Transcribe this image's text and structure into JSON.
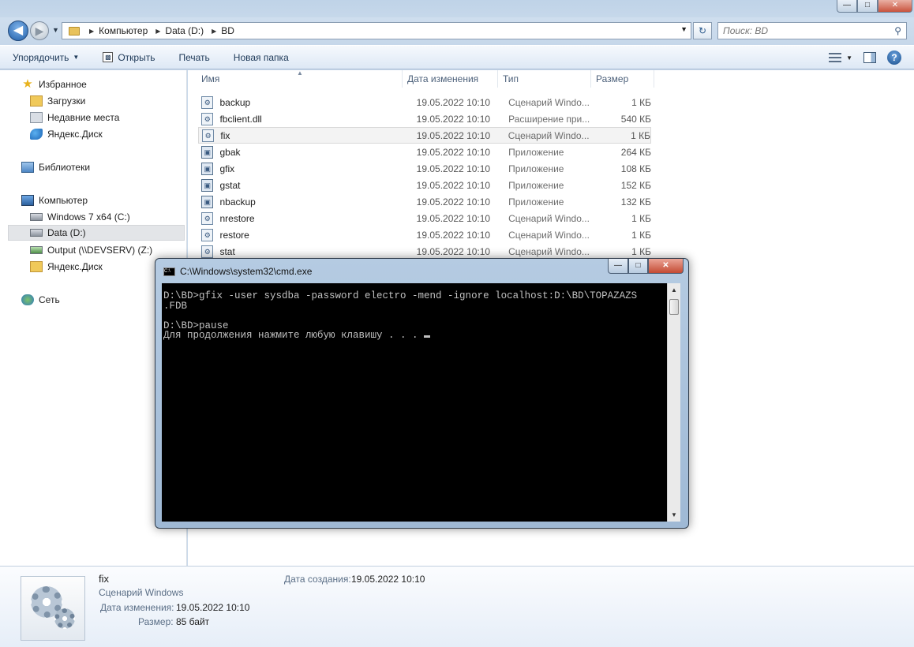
{
  "nav": {
    "crumbs": [
      "Компьютер",
      "Data (D:)",
      "BD"
    ],
    "search_placeholder": "Поиск: BD"
  },
  "toolbar": {
    "organize": "Упорядочить",
    "open": "Открыть",
    "print": "Печать",
    "new_folder": "Новая папка"
  },
  "sidebar": {
    "items": [
      {
        "label": "Избранное"
      },
      {
        "label": "Загрузки"
      },
      {
        "label": "Недавние места"
      },
      {
        "label": "Яндекс.Диск"
      },
      {
        "label": "Библиотеки"
      },
      {
        "label": "Компьютер"
      },
      {
        "label": "Windows 7 x64 (C:)"
      },
      {
        "label": "Data (D:)"
      },
      {
        "label": "Output (\\\\DEVSERV) (Z:)"
      },
      {
        "label": "Яндекс.Диск"
      },
      {
        "label": "Сеть"
      }
    ]
  },
  "files": {
    "columns": [
      "Имя",
      "Дата изменения",
      "Тип",
      "Размер"
    ],
    "rows": [
      {
        "name": "backup",
        "date": "19.05.2022 10:10",
        "type": "Сценарий Windo...",
        "size": "1 КБ"
      },
      {
        "name": "fbclient.dll",
        "date": "19.05.2022 10:10",
        "type": "Расширение при...",
        "size": "540 КБ"
      },
      {
        "name": "fix",
        "date": "19.05.2022 10:10",
        "type": "Сценарий Windo...",
        "size": "1 КБ"
      },
      {
        "name": "gbak",
        "date": "19.05.2022 10:10",
        "type": "Приложение",
        "size": "264 КБ"
      },
      {
        "name": "gfix",
        "date": "19.05.2022 10:10",
        "type": "Приложение",
        "size": "108 КБ"
      },
      {
        "name": "gstat",
        "date": "19.05.2022 10:10",
        "type": "Приложение",
        "size": "152 КБ"
      },
      {
        "name": "nbackup",
        "date": "19.05.2022 10:10",
        "type": "Приложение",
        "size": "132 КБ"
      },
      {
        "name": "nrestore",
        "date": "19.05.2022 10:10",
        "type": "Сценарий Windo...",
        "size": "1 КБ"
      },
      {
        "name": "restore",
        "date": "19.05.2022 10:10",
        "type": "Сценарий Windo...",
        "size": "1 КБ"
      },
      {
        "name": "stat",
        "date": "19.05.2022 10:10",
        "type": "Сценарий Windo...",
        "size": "1 КБ"
      }
    ]
  },
  "details": {
    "name": "fix",
    "type": "Сценарий Windows",
    "modified_label": "Дата изменения:",
    "modified": "19.05.2022 10:10",
    "size_label": "Размер:",
    "size": "85 байт",
    "created_label": "Дата создания:",
    "created": "19.05.2022 10:10"
  },
  "cmd": {
    "title": "C:\\Windows\\system32\\cmd.exe",
    "lines": [
      "D:\\BD>gfix -user sysdba -password electro -mend -ignore localhost:D:\\BD\\TOPAZAZS",
      ".FDB",
      "",
      "D:\\BD>pause",
      "Для продолжения нажмите любую клавишу . . . "
    ]
  }
}
